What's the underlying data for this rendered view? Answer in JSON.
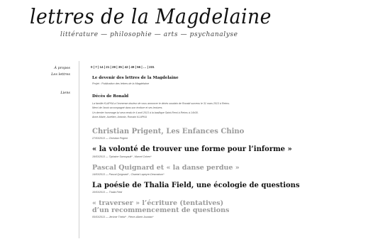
{
  "site": {
    "title": "lettres de la Magdelaine",
    "tagline": "littérature — philosophie — arts — psychanalyse"
  },
  "nav": {
    "items": [
      {
        "label": "À propos"
      },
      {
        "label": "Les lettres"
      },
      {
        "label": "Liens"
      }
    ]
  },
  "pager": {
    "text": "0 | 7 | 14 | 21 | 28 | 35 | 42 | 49 | 56 | … | 231"
  },
  "intro": {
    "title": "Le devenir des lettres de la Magdelaine",
    "subtitle": "Projet : Publication des lettres de la Magdelaine"
  },
  "deces": {
    "title": "Décès de Ronald",
    "lines": [
      "La famille KLAPKA a l’immense douleur de vous annoncer le décès soudain de Ronald survenu le 31 mars 2013 à Reims.",
      "Merci de l’avoir accompagné dans son écriture et ses lectures.",
      "Un dernier hommage lui sera rendu le 4 avril 2013 à la basilique Saint-Remi à Reims à 14h30.",
      "Anne-Marie, Aurélien, Antonin, Romain KLAPKA"
    ]
  },
  "posts": [
    {
      "title": "Christian Prigent, Les Enfances Chino",
      "title2": "",
      "meta": "27/03/2013 — Christian Prigent",
      "color": "gray"
    },
    {
      "title": "« la volonté de trouver une forme pour l’informe »",
      "title2": "",
      "meta": "19/03/2013 — Tiphaine Samoyault* , Marcel Cohen*",
      "color": "black"
    },
    {
      "title": "Pascal Quignard et « la danse perdue »",
      "title2": "",
      "meta": "14/03/2013 — Pascal Quignard* , Chantal Lapeyre-Desmaison*",
      "color": "gray"
    },
    {
      "title": "La poésie de Thalia Field, une écologie de questions",
      "title2": "",
      "meta": "10/03/2013 — Thalia Field",
      "color": "black"
    },
    {
      "title": "« traverser » l’écriture (tentatives)",
      "title2": "d’un recommencement de questions",
      "meta": "05/03/2013 — Jérôme Thélot* , Pierre-Albert Jourdan*",
      "color": "gray"
    }
  ]
}
